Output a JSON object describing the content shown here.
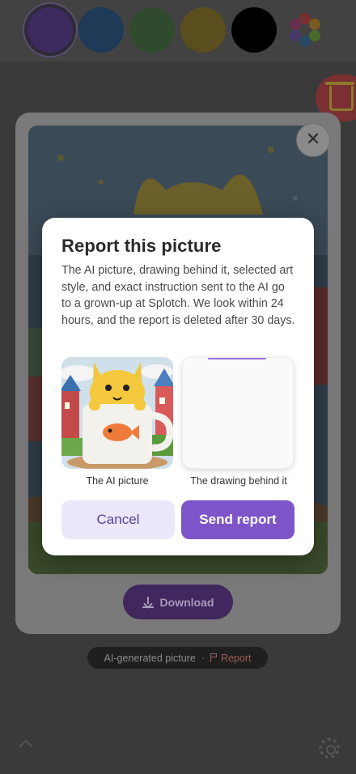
{
  "palette": {
    "colors": [
      "#3d2a5e",
      "#1f3a57",
      "#2f4a2c",
      "#5b4e1e",
      "#000000"
    ],
    "selected_index": 0,
    "rainbow_icon": "color-picker-icon"
  },
  "toolbar": {
    "trash_icon": "trash-icon"
  },
  "viewer": {
    "close_label": "✕",
    "download_label": "Download"
  },
  "badge": {
    "ai_label": "AI-generated picture",
    "separator": "·",
    "report_label": "Report"
  },
  "dialog": {
    "title": "Report this picture",
    "body": "The AI picture, drawing behind it, selected art style, and exact instruction sent to the AI go to a grown-up at Splotch. We look within 24 hours, and the report is deleted after 30 days.",
    "ai_caption": "The AI picture",
    "drawing_caption": "The drawing behind it",
    "cancel_label": "Cancel",
    "send_label": "Send report"
  },
  "colors": {
    "accent": "#7e55c8",
    "cancel_bg": "#ece7f8"
  }
}
